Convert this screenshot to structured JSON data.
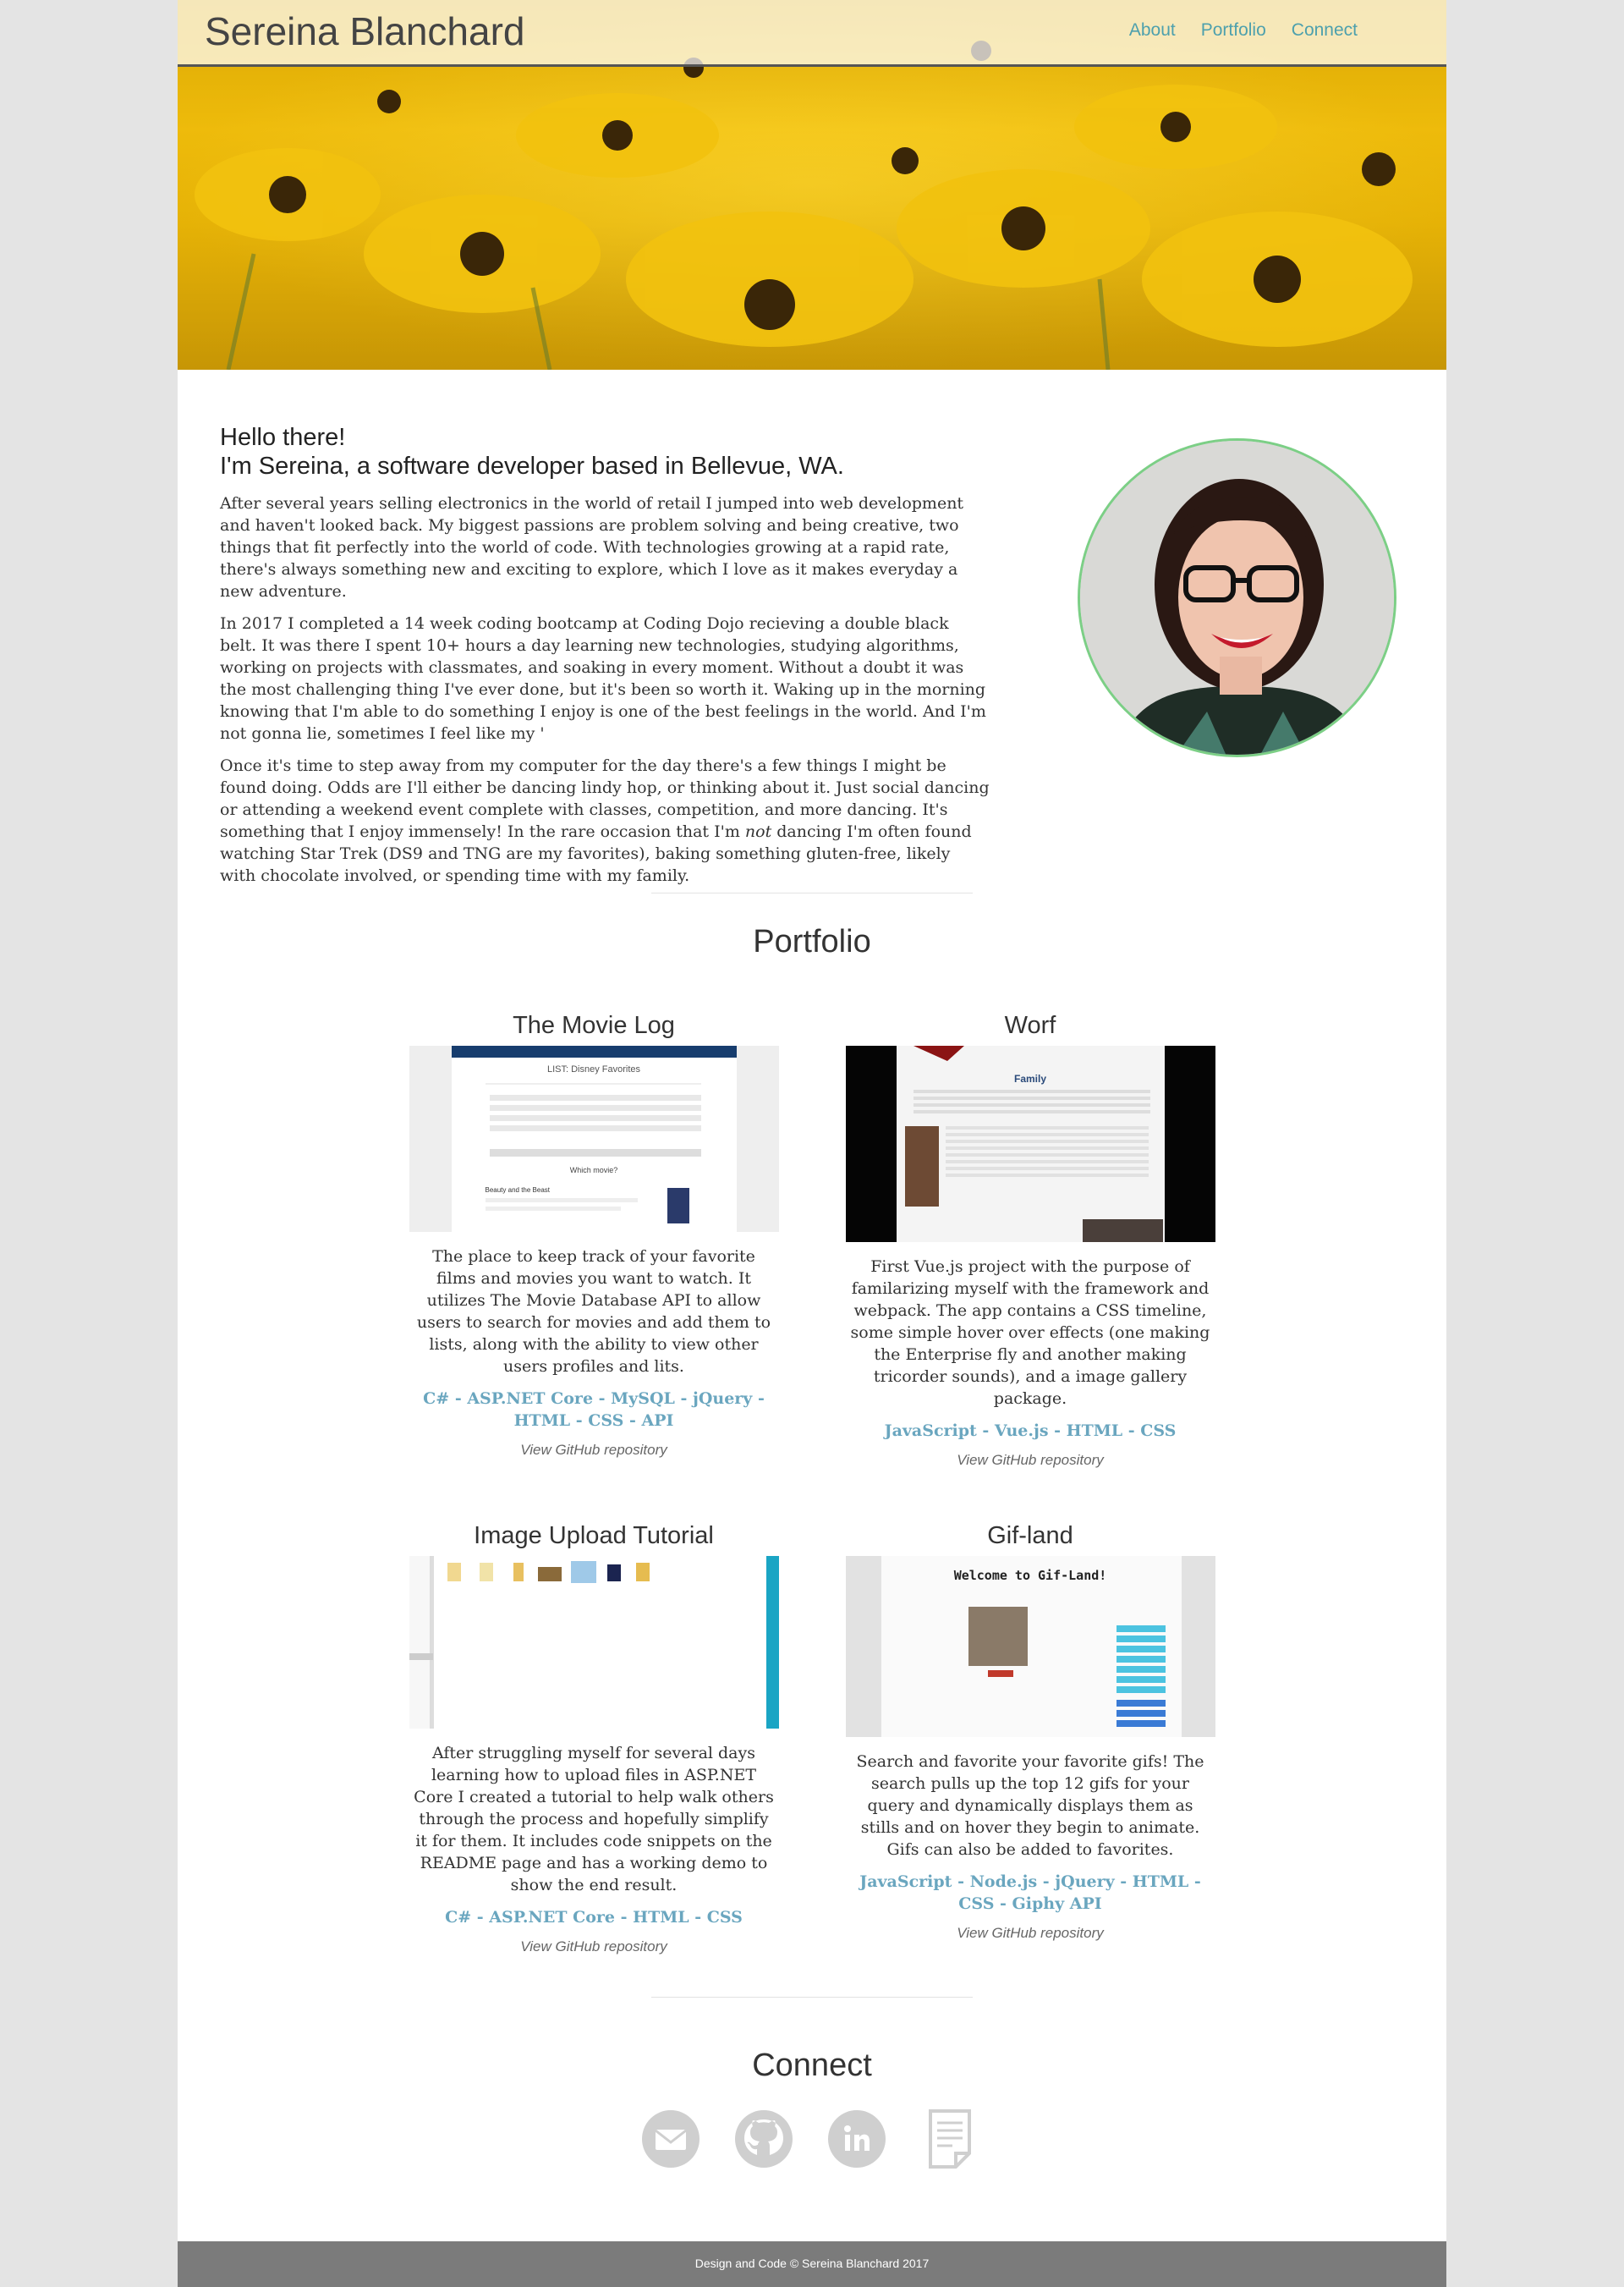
{
  "header": {
    "brand": "Sereina Blanchard",
    "nav": [
      "About",
      "Portfolio",
      "Connect"
    ]
  },
  "about": {
    "greeting": "Hello there!",
    "headline": "I'm Sereina, a software developer based in Bellevue, WA.",
    "paragraph_1": "After several years selling electronics in the world of retail I jumped into web development and haven't looked back. My biggest passions are problem solving and being creative, two things that fit perfectly into the world of code. With technologies growing at a rapid rate, there's always something new and exciting to explore, which I love as it makes everyday a new adventure.",
    "paragraph_2": "In 2017 I completed a 14 week coding bootcamp at Coding Dojo recieving a double black belt. It was there I spent 10+ hours a day learning new technologies, studying algorithms, working on projects with classmates, and soaking in every moment. Without a doubt it was the most challenging thing I've ever done, but it's been so worth it. Waking up in the morning knowing that I'm able to do something I enjoy is one of the best feelings in the world. And I'm not gonna lie, sometimes I feel like my '",
    "paragraph_3_before": "Once it's time to step away from my computer for the day there's a few things I might be found doing. Odds are I'll either be dancing lindy hop, or thinking about it. Just social dancing or attending a weekend event complete with classes, competition, and more dancing. It's something that I enjoy immensely! In the rare occasion that I'm ",
    "paragraph_3_em": "not",
    "paragraph_3_after": " dancing I'm often found watching Star Trek (DS9 and TNG are my favorites), baking something gluten-free, likely with chocolate involved, or spending time with my family."
  },
  "portfolio": {
    "title": "Portfolio",
    "projects": [
      {
        "title": "The Movie Log",
        "description": "The place to keep track of your favorite films and movies you want to watch. It utilizes The Movie Database API to allow users to search for movies and add them to lists, along with the ability to view other users profiles and lits.",
        "tech": "C# - ASP.NET Core - MySQL - jQuery - HTML - CSS - API",
        "repo": "View GitHub repository",
        "shot_heading": "LIST: Disney Favorites",
        "shot_sub": "Which movie?",
        "shot_item": "Beauty and the Beast"
      },
      {
        "title": "Worf",
        "description": "First Vue.js project with the purpose of familarizing myself with the framework and webpack. The app contains a CSS timeline, some simple hover over effects (one making the Enterprise fly and another making tricorder sounds), and a image gallery package.",
        "tech": "JavaScript - Vue.js - HTML - CSS",
        "repo": "View GitHub repository",
        "shot_heading": "Family"
      },
      {
        "title": "Image Upload Tutorial",
        "description": "After struggling myself for several days learning how to upload files in ASP.NET Core I created a tutorial to help walk others through the process and hopefully simplify it for them. It includes code snippets on the README page and has a working demo to show the end result.",
        "tech": "C# - ASP.NET Core - HTML - CSS",
        "repo": "View GitHub repository"
      },
      {
        "title": "Gif-land",
        "description": "Search and favorite your favorite gifs! The search pulls up the top 12 gifs for your query and dynamically displays them as stills and on hover they begin to animate. Gifs can also be added to favorites.",
        "tech": "JavaScript - Node.js - jQuery - HTML - CSS - Giphy API",
        "repo": "View GitHub repository",
        "shot_heading": "Welcome to Gif-Land!"
      }
    ]
  },
  "connect": {
    "title": "Connect",
    "icons": [
      "email-icon",
      "github-icon",
      "linkedin-icon",
      "resume-icon"
    ]
  },
  "footer": {
    "text": "Design and Code © Sereina Blanchard 2017"
  },
  "colors": {
    "accent": "#4da0ad",
    "tech_link": "#6aa6bf",
    "avatar_border": "#7ccf86",
    "footer_bg": "#7b7b7b",
    "icon_gray": "#cfcfcf"
  }
}
